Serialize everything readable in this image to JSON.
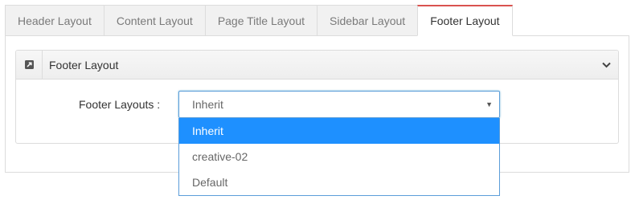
{
  "tabs": [
    {
      "label": "Header Layout",
      "active": false
    },
    {
      "label": "Content Layout",
      "active": false
    },
    {
      "label": "Page Title Layout",
      "active": false
    },
    {
      "label": "Sidebar Layout",
      "active": false
    },
    {
      "label": "Footer Layout",
      "active": true
    }
  ],
  "panel": {
    "title": "Footer Layout",
    "icon": "external-link-icon",
    "toggle_icon": "chevron-down-icon"
  },
  "field": {
    "label": "Footer Layouts :",
    "value": "Inherit",
    "arrow": "▼",
    "options": [
      {
        "label": "Inherit",
        "selected": true
      },
      {
        "label": "creative-02",
        "selected": false
      },
      {
        "label": "Default",
        "selected": false
      }
    ]
  },
  "colors": {
    "active_tab_accent": "#d9534f",
    "selected_option_bg": "#1e90ff",
    "focus_border": "#5b9dd9"
  }
}
